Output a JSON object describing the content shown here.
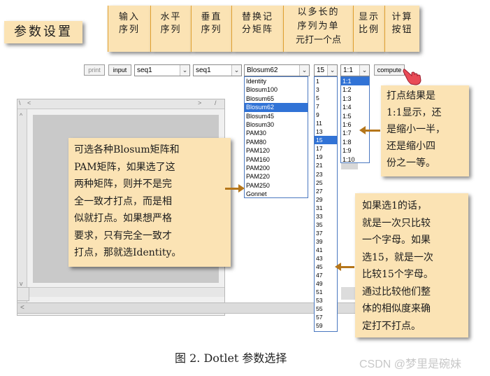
{
  "title_note": "参数设置",
  "header_notes": [
    {
      "line1": "输入",
      "line2": "序列"
    },
    {
      "line1": "水平",
      "line2": "序列"
    },
    {
      "line1": "垂直",
      "line2": "序列"
    },
    {
      "line1": "替换记",
      "line2": "分矩阵"
    },
    {
      "line1": "以多长的",
      "line2": "序列为单",
      "line3": "元打一个点"
    },
    {
      "line1": "显示",
      "line2": "比例"
    },
    {
      "line1": "计算",
      "line2": "按钮"
    }
  ],
  "toolbar": {
    "print_label": "print",
    "input_label": "input",
    "horizontal_seq": "seq1",
    "vertical_seq": "seq1",
    "matrix": "Blosum62",
    "window": "15",
    "ratio": "1:1",
    "compute_label": "compute"
  },
  "matrix_options": [
    "Identity",
    "Blosum100",
    "Blosum65",
    "Blosum62",
    "Blosum45",
    "Blosum30",
    "PAM30",
    "PAM80",
    "PAM120",
    "PAM160",
    "PAM200",
    "PAM220",
    "PAM250",
    "Gonnet"
  ],
  "window_options": [
    "1",
    "3",
    "5",
    "7",
    "9",
    "11",
    "13",
    "15",
    "17",
    "19",
    "21",
    "23",
    "25",
    "27",
    "29",
    "31",
    "33",
    "35",
    "37",
    "39",
    "41",
    "43",
    "45",
    "47",
    "49",
    "51",
    "53",
    "55",
    "57",
    "59"
  ],
  "ratio_options": [
    "1:1",
    "1:2",
    "1:3",
    "1:4",
    "1:5",
    "1:6",
    "1:7",
    "1:8",
    "1:9",
    "1:10"
  ],
  "notes": {
    "ratio_note": [
      "打点结果是",
      "1:1显示，还",
      "是缩小一半，",
      "还是缩小四",
      "份之一等。"
    ],
    "matrix_note": [
      "可选各种Blosum矩阵和",
      "PAM矩阵，如果选了这",
      "两种矩阵，则并不是完",
      "全一致才打点，而是相",
      "似就打点。如果想严格",
      "要求，只有完全一致才",
      "打点，那就选Identity。"
    ],
    "window_note": [
      "如果选1的话，",
      "就是一次只比较",
      "一个字母。如果",
      "选15，就是一次",
      "比较15个字母。",
      "通过比较他们整",
      "体的相似度来确",
      "定打不打点。"
    ]
  },
  "caption": "图 2. Dotlet 参数选择",
  "watermark": "CSDN @梦里是碗妹",
  "colors": {
    "note_bg": "#fbe3b4",
    "arrow": "#b5761a",
    "highlight": "#3173d6"
  }
}
